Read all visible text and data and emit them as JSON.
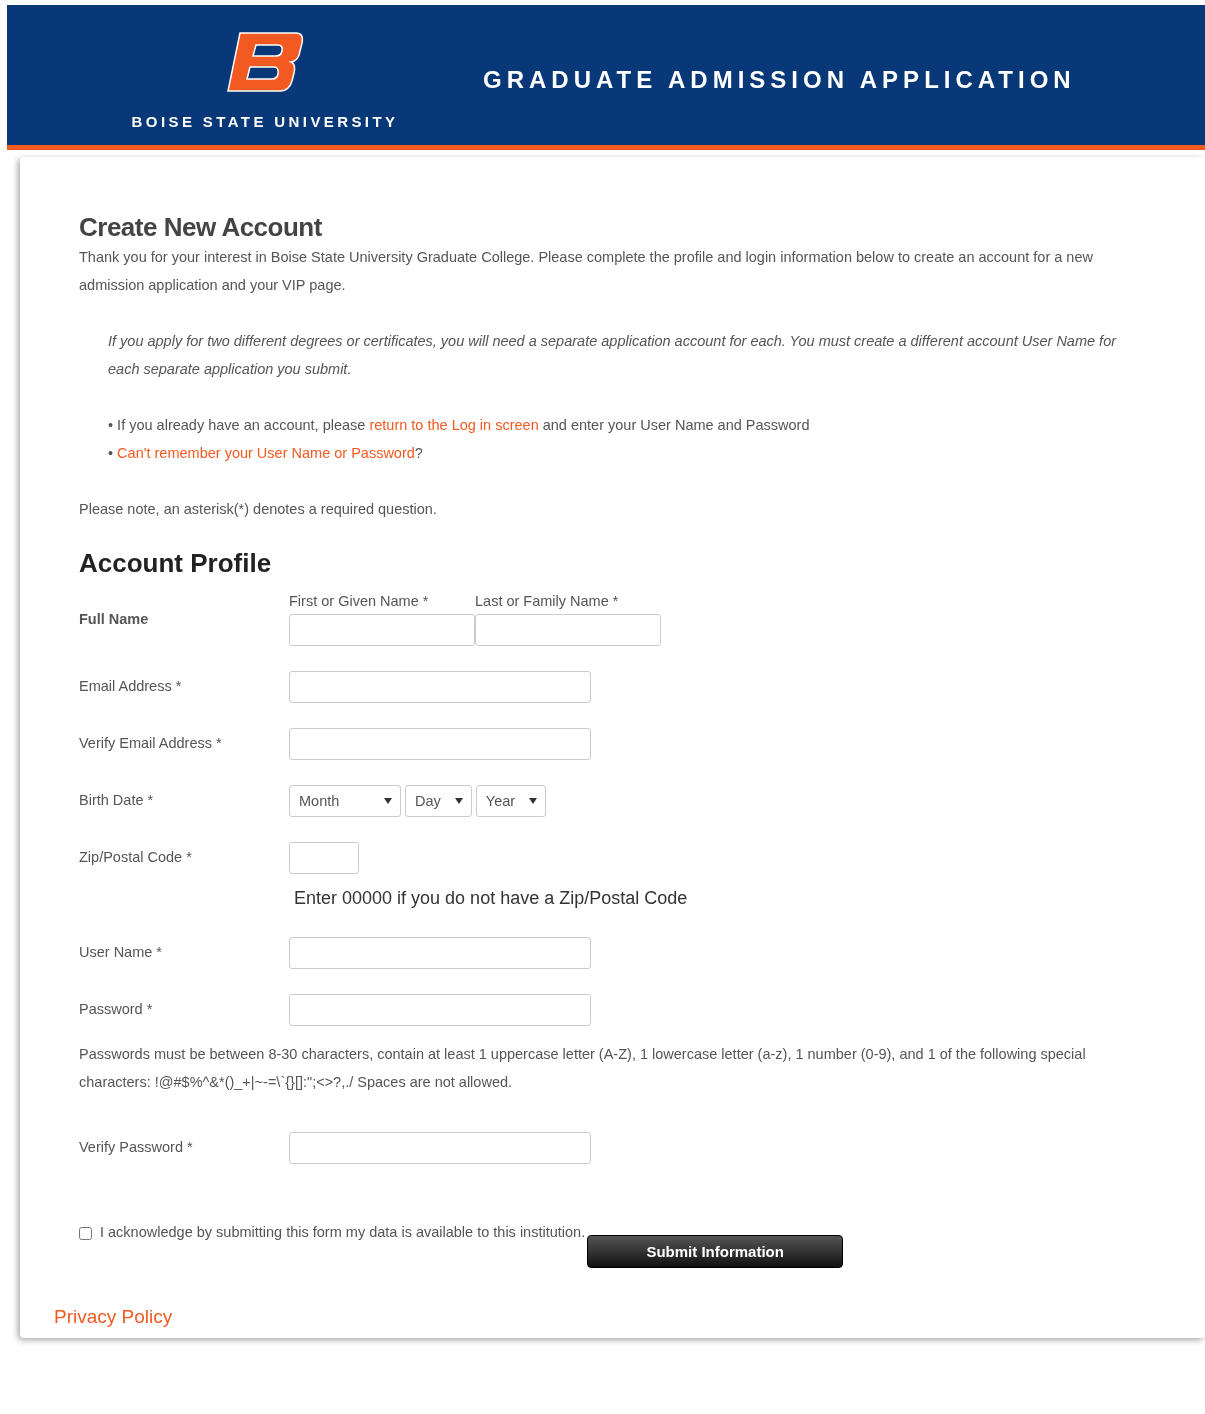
{
  "header": {
    "university": "BOISE STATE UNIVERSITY",
    "title": "GRADUATE ADMISSION APPLICATION"
  },
  "intro": {
    "heading": "Create New Account",
    "text": "Thank you for your interest in Boise State University Graduate College. Please complete the profile and login information below to create an account for a new admission application and your VIP page.",
    "note": "If you apply for two different degrees or certificates, you will need a separate application account for each. You must create a different account User Name for each separate application you submit.",
    "bullets": [
      {
        "bullet": "•",
        "parts": [
          {
            "kind": "text",
            "text": "If you already have an account, please"
          },
          {
            "kind": "link",
            "text": "return to the Log in screen"
          },
          {
            "kind": "text",
            "text": "and enter your User Name and Password"
          }
        ]
      },
      {
        "bullet": "•",
        "parts": [
          {
            "kind": "link",
            "text": "Can't remember your User Name or Password"
          },
          {
            "kind": "tail",
            "text": "?"
          }
        ]
      }
    ],
    "required_note": "Please note, an asterisk(*) denotes a required question."
  },
  "profile": {
    "heading": "Account Profile",
    "rows": [
      {
        "kind": "name",
        "label": "Full Name",
        "subfields": [
          {
            "label": "First or Given Name *"
          },
          {
            "label": "Last or Family Name *"
          }
        ]
      },
      {
        "kind": "text",
        "label": "Email Address *"
      },
      {
        "kind": "text",
        "label": "Verify Email Address *"
      },
      {
        "kind": "date",
        "label": "Birth Date *",
        "selects": [
          "Month",
          "Day",
          "Year"
        ]
      },
      {
        "kind": "zip",
        "label": "Zip/Postal Code *",
        "hint": "Enter 00000 if you do not have a Zip/Postal Code"
      },
      {
        "kind": "text",
        "label": "User Name *"
      },
      {
        "kind": "text",
        "label": "Password *"
      },
      {
        "kind": "note",
        "text": "Passwords must be between 8-30 characters, contain at least 1 uppercase letter (A-Z), 1 lowercase letter (a-z), 1 number (0-9), and 1 of the following special characters: !@#$%^&*()_+|~-=\\`{}[]:\";<>?,./ Spaces are not allowed."
      },
      {
        "kind": "text",
        "label": "Verify Password *"
      }
    ]
  },
  "acknowledge": {
    "label": "I acknowledge by submitting this form my data is available to this institution.",
    "checked": false
  },
  "submit": "Submit Information",
  "privacy": "Privacy Policy"
}
